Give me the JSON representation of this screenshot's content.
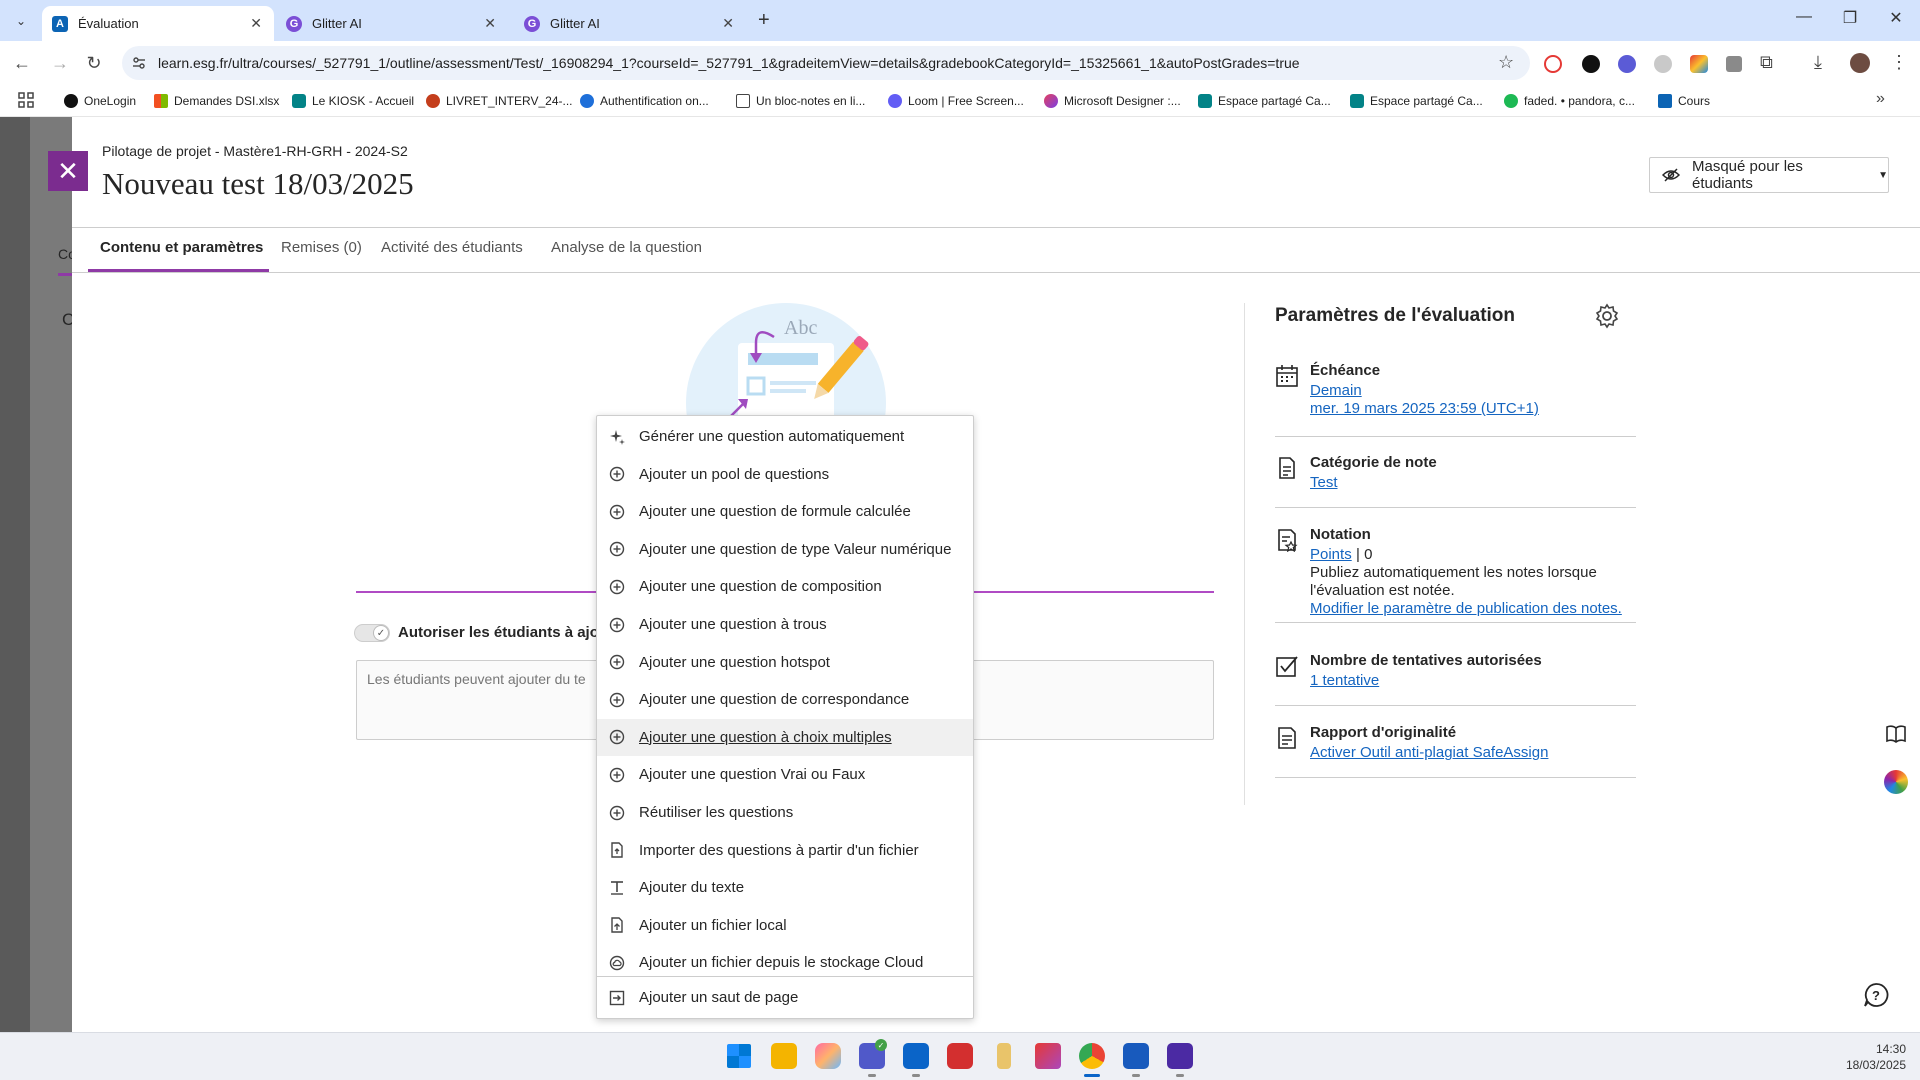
{
  "browser": {
    "tabs": [
      {
        "label": "Évaluation",
        "active": true
      },
      {
        "label": "Glitter AI",
        "active": false
      },
      {
        "label": "Glitter AI",
        "active": false
      }
    ],
    "url": "learn.esg.fr/ultra/courses/_527791_1/outline/assessment/Test/_16908294_1?courseId=_527791_1&gradeitemView=details&gradebookCategoryId=_15325661_1&autoPostGrades=true",
    "bookmarks": [
      "OneLogin",
      "Demandes DSI.xlsx",
      "Le KIOSK - Accueil",
      "LIVRET_INTERV_24-...",
      "Authentification on...",
      "Un bloc-notes en li...",
      "Loom | Free Screen...",
      "Microsoft Designer :...",
      "Espace partagé Ca...",
      "Espace partagé Ca...",
      "faded. • pandora, c...",
      "Cours"
    ]
  },
  "page": {
    "breadcrumb": "Pilotage de projet - Mastère1-RH-GRH - 2024-S2",
    "title": "Nouveau test 18/03/2025",
    "visibility": "Masqué pour les étudiants",
    "tabs": [
      "Contenu et paramètres",
      "Remises (0)",
      "Activité des étudiants",
      "Analyse de la question"
    ],
    "left_tab_stub": "Co",
    "left_letter_stub": "C",
    "toggle_label": "Autoriser les étudiants à ajou",
    "textbox_placeholder": "Les étudiants peuvent ajouter du te"
  },
  "menu": {
    "items": [
      {
        "label": "Générer une question automatiquement",
        "icon": "sparkle-icon"
      },
      {
        "label": "Ajouter un pool de questions",
        "icon": "plus-circle-icon"
      },
      {
        "label": "Ajouter une question de formule calculée",
        "icon": "plus-circle-icon"
      },
      {
        "label": "Ajouter une question de type Valeur numérique",
        "icon": "plus-circle-icon"
      },
      {
        "label": "Ajouter une question de composition",
        "icon": "plus-circle-icon"
      },
      {
        "label": "Ajouter une question à trous",
        "icon": "plus-circle-icon"
      },
      {
        "label": "Ajouter une question hotspot",
        "icon": "plus-circle-icon"
      },
      {
        "label": "Ajouter une question de correspondance",
        "icon": "plus-circle-icon"
      },
      {
        "label": "Ajouter une question à choix multiples",
        "icon": "plus-circle-icon",
        "hover": true
      },
      {
        "label": "Ajouter une question Vrai ou Faux",
        "icon": "plus-circle-icon"
      },
      {
        "label": "Réutiliser les questions",
        "icon": "plus-circle-icon"
      },
      {
        "label": "Importer des questions à partir d'un fichier",
        "icon": "file-import-icon"
      },
      {
        "label": "Ajouter du texte",
        "icon": "text-icon"
      },
      {
        "label": "Ajouter un fichier local",
        "icon": "file-upload-icon"
      },
      {
        "label": "Ajouter un fichier depuis le stockage Cloud",
        "icon": "cloud-icon"
      },
      {
        "label": "Ajouter un saut de page",
        "icon": "page-break-icon"
      }
    ]
  },
  "settings": {
    "title": "Paramètres de l'évaluation",
    "due": {
      "label": "Échéance",
      "link1": "Demain",
      "link2": "mer. 19 mars 2025 23:59 (UTC+1)"
    },
    "category": {
      "label": "Catégorie de note",
      "link": "Test"
    },
    "grading": {
      "label": "Notation",
      "link": "Points",
      "sep": " | 0",
      "text1": "Publiez automatiquement les notes lorsque",
      "text2": "l'évaluation est notée.",
      "link2": "Modifier le paramètre de publication des notes."
    },
    "attempts": {
      "label": "Nombre de tentatives autorisées",
      "link": "1 tentative"
    },
    "originality": {
      "label": "Rapport d'originalité",
      "link": "Activer Outil anti-plagiat SafeAssign"
    }
  },
  "taskbar": {
    "time": "14:30",
    "date": "18/03/2025"
  },
  "colors": {
    "accent": "#8f3aa6",
    "link": "#1565c0",
    "close_bg": "#7b2c8f"
  }
}
